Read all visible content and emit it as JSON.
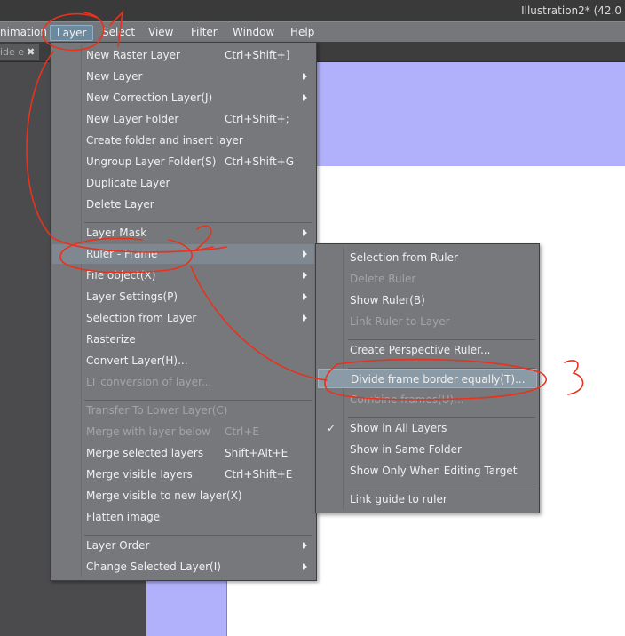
{
  "window": {
    "title": "Illustration2* (42.0"
  },
  "menubar": [
    "nimation",
    "Layer",
    "Select",
    "View",
    "Filter",
    "Window",
    "Help"
  ],
  "tab": {
    "label": "ide e"
  },
  "layer_menu": [
    {
      "label": "New Raster Layer",
      "shortcut": "Ctrl+Shift+]"
    },
    {
      "label": "New Layer",
      "submenu": true
    },
    {
      "label": "New Correction Layer(J)",
      "submenu": true
    },
    {
      "label": "New Layer Folder",
      "shortcut": "Ctrl+Shift+;"
    },
    {
      "label": "Create folder and insert layer"
    },
    {
      "label": "Ungroup Layer Folder(S)",
      "shortcut": "Ctrl+Shift+G"
    },
    {
      "label": "Duplicate Layer"
    },
    {
      "label": "Delete Layer"
    },
    {
      "sep": true
    },
    {
      "label": "Layer Mask",
      "submenu": true
    },
    {
      "label": "Ruler - Frame",
      "submenu": true,
      "highlighted": true
    },
    {
      "label": "File object(X)",
      "submenu": true
    },
    {
      "label": "Layer Settings(P)",
      "submenu": true
    },
    {
      "label": "Selection from Layer",
      "submenu": true
    },
    {
      "label": "Rasterize"
    },
    {
      "label": "Convert Layer(H)..."
    },
    {
      "label": "LT conversion of layer...",
      "disabled": true
    },
    {
      "sep": true
    },
    {
      "label": "Transfer To Lower Layer(C)",
      "disabled": true
    },
    {
      "label": "Merge with layer below",
      "shortcut": "Ctrl+E",
      "disabled": true
    },
    {
      "label": "Merge selected layers",
      "shortcut": "Shift+Alt+E"
    },
    {
      "label": "Merge visible layers",
      "shortcut": "Ctrl+Shift+E"
    },
    {
      "label": "Merge visible to new layer(X)"
    },
    {
      "label": "Flatten image"
    },
    {
      "sep": true
    },
    {
      "label": "Layer Order",
      "submenu": true
    },
    {
      "label": "Change Selected Layer(I)",
      "submenu": true
    }
  ],
  "ruler_frame_menu": [
    {
      "label": "Selection from Ruler"
    },
    {
      "label": "Delete Ruler",
      "disabled": true
    },
    {
      "label": "Show Ruler(B)"
    },
    {
      "label": "Link Ruler to Layer",
      "disabled": true
    },
    {
      "sep": true
    },
    {
      "label": "Create Perspective Ruler..."
    },
    {
      "sep": true
    },
    {
      "label": "Divide frame border equally(T)...",
      "highlighted": true
    },
    {
      "label": "Combine frames(U)...",
      "disabled": true
    },
    {
      "sep": true
    },
    {
      "label": "Show in All Layers",
      "checked": true
    },
    {
      "label": "Show in Same Folder"
    },
    {
      "label": "Show Only When Editing Target"
    },
    {
      "sep": true
    },
    {
      "label": "Link guide to ruler"
    }
  ],
  "check_glyph": "✓",
  "annotations": [
    "1",
    "2",
    "3"
  ],
  "colors": {
    "annotation": "#e8321e",
    "canvas": "#b1b1fb",
    "menu": "#77787b",
    "highlight": "#8a9aa6"
  }
}
